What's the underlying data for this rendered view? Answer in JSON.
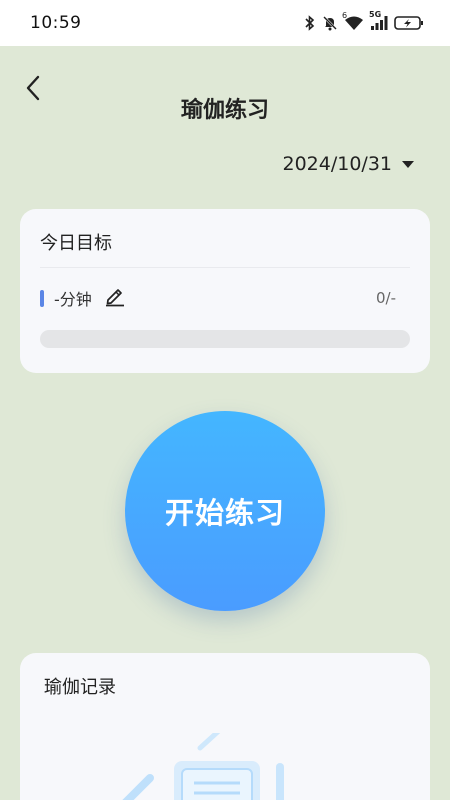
{
  "status_bar": {
    "time": "10:59",
    "network_label": "5G",
    "wifi_label": "6",
    "icons": [
      "bluetooth-icon",
      "mute-icon",
      "wifi-icon",
      "signal-icon",
      "battery-charging-icon"
    ]
  },
  "header": {
    "back_icon": "chevron-left-icon",
    "title": "瑜伽练习"
  },
  "date_select": {
    "value": "2024/10/31",
    "icon": "caret-down-icon"
  },
  "goal_card": {
    "title": "今日目标",
    "minutes": "-分钟",
    "edit_icon": "edit-pencil-icon",
    "count": "0/-",
    "progress": 0
  },
  "start_button": {
    "label": "开始练习"
  },
  "record_card": {
    "title": "瑜伽记录",
    "empty_icon": "empty-document-icon"
  },
  "colors": {
    "background": "#dfe8d6",
    "accent": "#4aa6ff",
    "goal_marker": "#5b86e6"
  }
}
